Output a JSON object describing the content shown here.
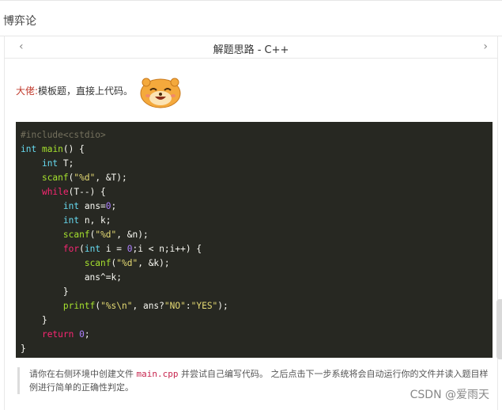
{
  "header": {
    "title": "博弈论"
  },
  "subheader": {
    "title": "解题思路 - C++",
    "prev_icon": "‹",
    "next_icon": "›"
  },
  "intro": {
    "speaker": "大佬:",
    "text": "模板题，直接上代码。"
  },
  "emoji": {
    "name": "bear-laughing-emoji"
  },
  "code": {
    "language": "C++",
    "lines": [
      "#include<cstdio>",
      "int main() {",
      "    int T;",
      "    scanf(\"%d\", &T);",
      "    while(T--) {",
      "        int ans=0;",
      "        int n, k;",
      "        scanf(\"%d\", &n);",
      "        for(int i = 0;i < n;i++) {",
      "            scanf(\"%d\", &k);",
      "            ans^=k;",
      "        }",
      "        printf(\"%s\\n\", ans?\"NO\":\"YES\");",
      "    }",
      "    return 0;",
      "}"
    ]
  },
  "tip": {
    "part1": "请你在右侧环境中创建文件 ",
    "filename": "main.cpp",
    "part2": " 并尝试自己编写代码。 之后点击下一步系统将会自动运行你的文件并读入题目样例进行简单的正确性判定。"
  },
  "watermark": "CSDN @爱雨天",
  "colors": {
    "code_bg": "#272822",
    "speaker": "#c0392b"
  }
}
